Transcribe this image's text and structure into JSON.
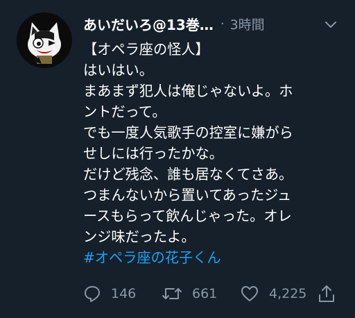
{
  "tweet": {
    "user": {
      "display_name": "あいだいろ@13巻…",
      "avatar_icon": "cat-avatar-icon"
    },
    "time": "3時間",
    "separator": "·",
    "lines": [
      "【オペラ座の怪人】",
      "はいはい。",
      "まあまず犯人は俺じゃないよ。ホ",
      "ントだって。",
      "でも一度人気歌手の控室に嫌がら",
      "せしには行ったかな。",
      "だけど残念、誰も居なくてさあ。",
      "つまんないから置いてあったジュ",
      "ースもらって飲んじゃった。オレ",
      "ンジ味だったよ。"
    ],
    "hashtag": "#オペラ座の花子くん",
    "actions": {
      "reply": {
        "icon": "reply-icon",
        "count": "146"
      },
      "retweet": {
        "icon": "retweet-icon",
        "count": "661"
      },
      "like": {
        "icon": "heart-icon",
        "count": "4,225"
      },
      "share": {
        "icon": "share-icon"
      }
    }
  },
  "colors": {
    "background": "#15202b",
    "text": "#ffffff",
    "secondary": "#8899a6",
    "link": "#1da1f2"
  }
}
